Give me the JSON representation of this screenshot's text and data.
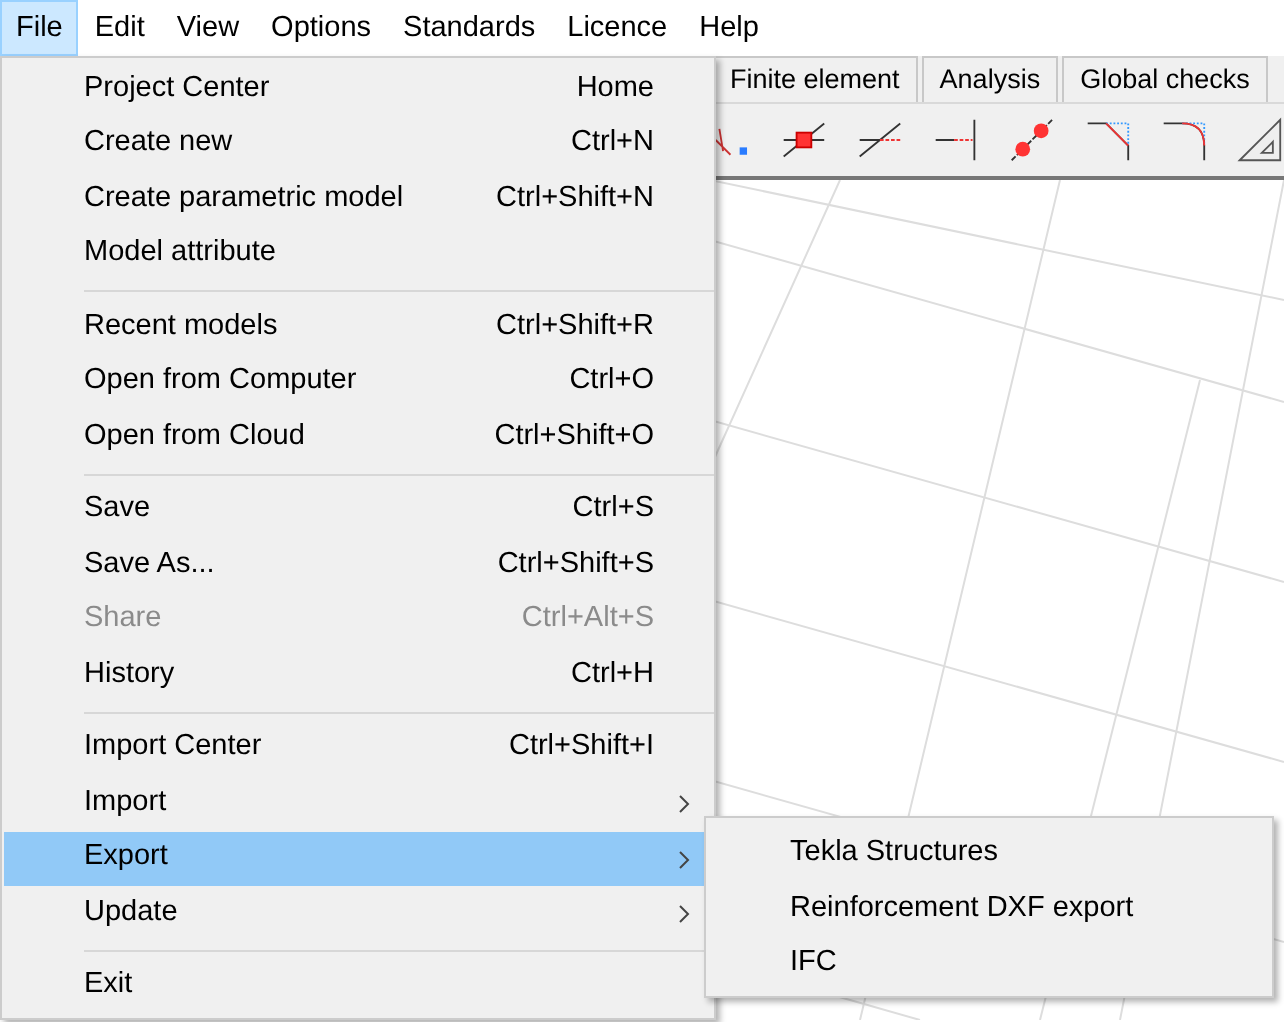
{
  "menu_bar": [
    {
      "label": "File",
      "selected": true
    },
    {
      "label": "Edit",
      "selected": false
    },
    {
      "label": "View",
      "selected": false
    },
    {
      "label": "Options",
      "selected": false
    },
    {
      "label": "Standards",
      "selected": false
    },
    {
      "label": "Licence",
      "selected": false
    },
    {
      "label": "Help",
      "selected": false
    }
  ],
  "tabs": [
    {
      "label": "Finite element",
      "selected": false
    },
    {
      "label": "Analysis",
      "selected": false
    },
    {
      "label": "Global checks",
      "selected": false
    }
  ],
  "file_menu": [
    {
      "kind": "item",
      "label": "Project Center",
      "shortcut": "Home",
      "disabled": false,
      "selected": false
    },
    {
      "kind": "item",
      "label": "Create new",
      "shortcut": "Ctrl+N",
      "disabled": false,
      "selected": false
    },
    {
      "kind": "item",
      "label": "Create parametric model",
      "shortcut": "Ctrl+Shift+N",
      "disabled": false,
      "selected": false
    },
    {
      "kind": "item",
      "label": "Model attribute",
      "disabled": false,
      "selected": false
    },
    {
      "kind": "separator"
    },
    {
      "kind": "item",
      "label": "Recent models",
      "shortcut": "Ctrl+Shift+R",
      "disabled": false,
      "selected": false
    },
    {
      "kind": "item",
      "label": "Open from Computer",
      "shortcut": "Ctrl+O",
      "disabled": false,
      "selected": false
    },
    {
      "kind": "item",
      "label": "Open from Cloud",
      "shortcut": "Ctrl+Shift+O",
      "disabled": false,
      "selected": false
    },
    {
      "kind": "separator"
    },
    {
      "kind": "item",
      "label": "Save",
      "shortcut": "Ctrl+S",
      "disabled": false,
      "selected": false
    },
    {
      "kind": "item",
      "label": "Save As...",
      "shortcut": "Ctrl+Shift+S",
      "disabled": false,
      "selected": false
    },
    {
      "kind": "item",
      "label": "Share",
      "shortcut": "Ctrl+Alt+S",
      "disabled": true,
      "selected": false
    },
    {
      "kind": "item",
      "label": "History",
      "shortcut": "Ctrl+H",
      "disabled": false,
      "selected": false
    },
    {
      "kind": "separator"
    },
    {
      "kind": "item",
      "label": "Import Center",
      "shortcut": "Ctrl+Shift+I",
      "disabled": false,
      "selected": false
    },
    {
      "kind": "submenu",
      "label": "Import",
      "disabled": false,
      "selected": false
    },
    {
      "kind": "submenu",
      "label": "Export",
      "disabled": false,
      "selected": true
    },
    {
      "kind": "submenu",
      "label": "Update",
      "disabled": false,
      "selected": false
    },
    {
      "kind": "separator"
    },
    {
      "kind": "item",
      "label": "Exit",
      "disabled": false,
      "selected": false
    }
  ],
  "export_submenu": [
    {
      "label": "Tekla Structures"
    },
    {
      "label": "Reinforcement DXF export"
    },
    {
      "label": "IFC"
    }
  ]
}
